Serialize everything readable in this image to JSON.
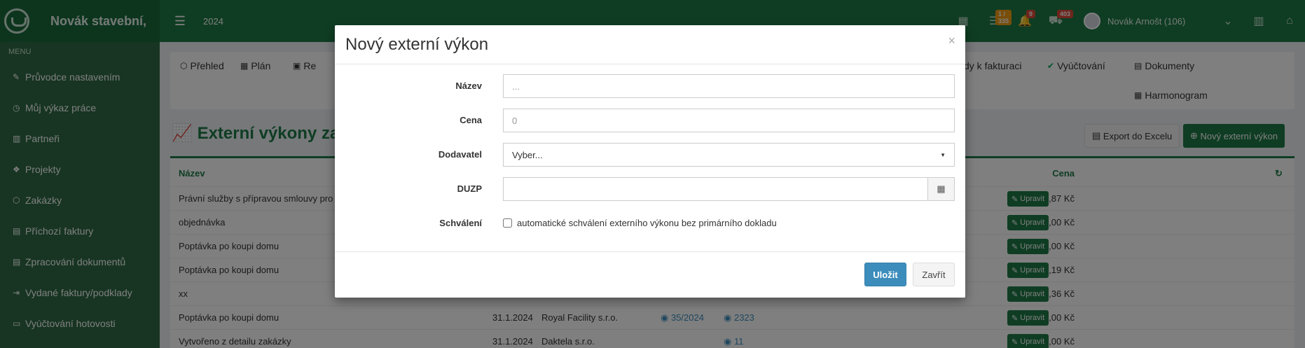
{
  "header": {
    "brand": "Novák stavební,",
    "year": "2024",
    "badges": {
      "tasks": "1 / 335",
      "bell": "9",
      "orders": "403"
    },
    "user": "Novák Arnošt (106)"
  },
  "sidebar": {
    "menu_header": "MENU",
    "items": [
      {
        "label": "Průvodce nastavením",
        "icon": "pencil-icon"
      },
      {
        "label": "Můj výkaz práce",
        "icon": "clock-icon"
      },
      {
        "label": "Partneři",
        "icon": "building-icon"
      },
      {
        "label": "Projekty",
        "icon": "cubes-icon"
      },
      {
        "label": "Zakázky",
        "icon": "cube-icon"
      },
      {
        "label": "Příchozí faktury",
        "icon": "file-icon"
      },
      {
        "label": "Zpracování dokumentů",
        "icon": "file-icon"
      },
      {
        "label": "Vydané faktury/podklady",
        "icon": "file-export-icon"
      },
      {
        "label": "Vyúčtování hotovosti",
        "icon": "money-icon"
      }
    ]
  },
  "tabs": {
    "prehled": "Přehled",
    "plan": "Plán",
    "re": "Re",
    "podklady": "dy k fakturaci",
    "vyuctovani": "Vyúčtování",
    "dokumenty": "Dokumenty",
    "harmonogram": "Harmonogram"
  },
  "page": {
    "title": "Externí výkony za",
    "export_label": "Export do Excelu",
    "new_label": "Nový externí výkon"
  },
  "table": {
    "headers": {
      "name": "Název",
      "price": "Cena"
    },
    "edit_label": "Upravit",
    "rows": [
      {
        "name": "Právní služby s přípravou smlouvy pro",
        "date": "",
        "supplier": "",
        "doc": "",
        "ext": "",
        "price": "2 295,87 Kč"
      },
      {
        "name": "objednávka",
        "date": "",
        "supplier": "",
        "doc": "",
        "ext": "",
        "price": "200,00 Kč"
      },
      {
        "name": "Poptávka po koupi domu",
        "date": "",
        "supplier": "",
        "doc": "",
        "ext": "",
        "price": "1 050,00 Kč"
      },
      {
        "name": "Poptávka po koupi domu",
        "date": "",
        "supplier": "",
        "doc": "",
        "ext": "",
        "price": "1 848,19 Kč"
      },
      {
        "name": "xx",
        "date": "",
        "supplier": "",
        "doc": "",
        "ext": "",
        "price": "1 717,36 Kč"
      },
      {
        "name": "Poptávka po koupi domu",
        "date": "31.1.2024",
        "supplier": "Royal Facility s.r.o.",
        "doc": "35/2024",
        "ext": "2323",
        "price": "200 000,00 Kč"
      },
      {
        "name": "Vytvořeno z detailu zakázky",
        "date": "31.1.2024",
        "supplier": "Daktela s.r.o.",
        "doc": "",
        "ext": "11",
        "price": "5 500,00 Kč"
      }
    ]
  },
  "modal": {
    "title": "Nový externí výkon",
    "close_glyph": "×",
    "fields": {
      "name_label": "Název",
      "name_placeholder": "...",
      "price_label": "Cena",
      "price_placeholder": "0",
      "supplier_label": "Dodavatel",
      "supplier_value": "Vyber...",
      "duzp_label": "DUZP",
      "approval_label": "Schválení",
      "approval_text": "automatické schválení externího výkonu bez primárního dokladu"
    },
    "save_label": "Uložit",
    "close_label": "Zavřít"
  }
}
